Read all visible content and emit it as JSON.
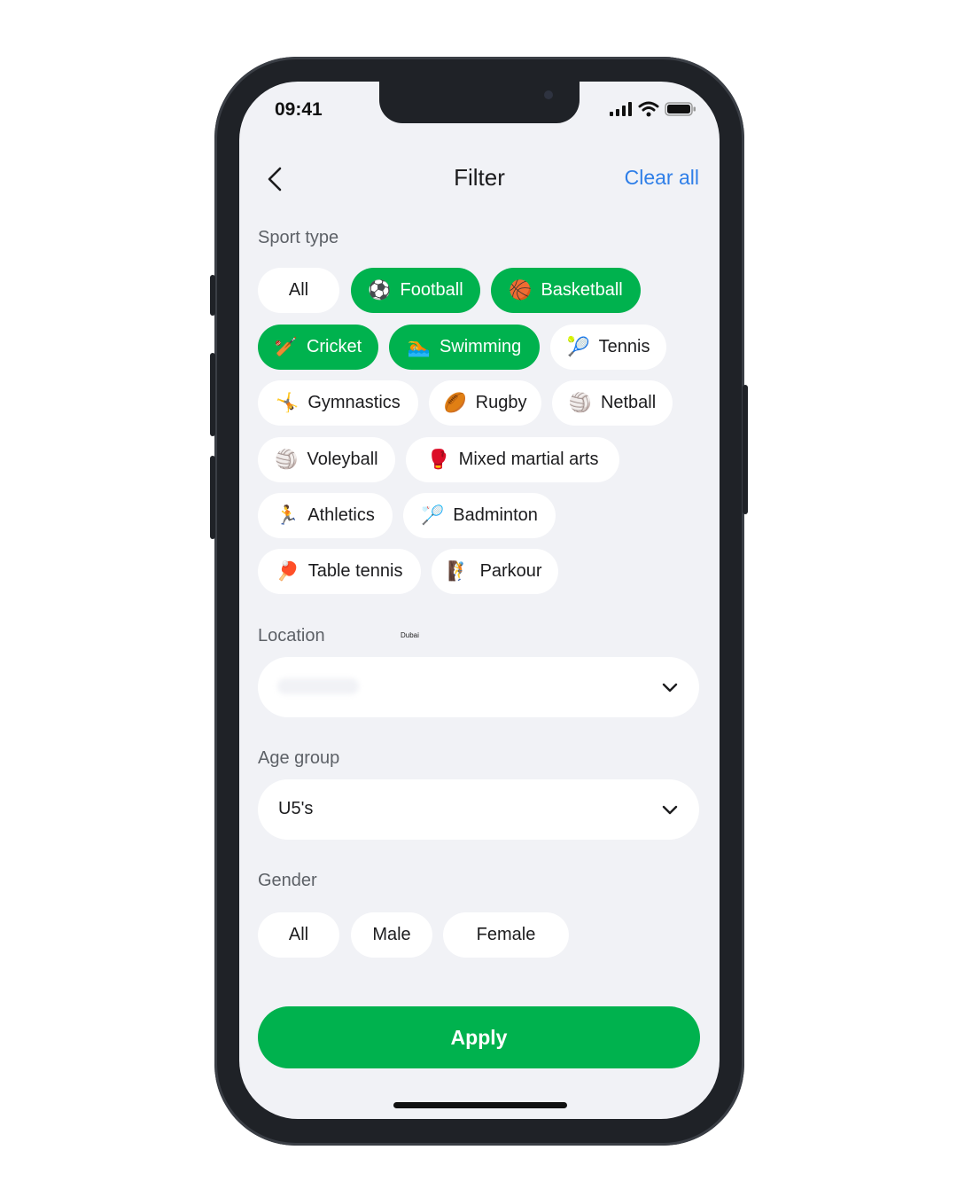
{
  "status": {
    "time": "09:41"
  },
  "header": {
    "title": "Filter",
    "clear_label": "Clear all"
  },
  "sport_type": {
    "label": "Sport type",
    "chips": [
      {
        "label": "All",
        "emoji": "",
        "selected": false
      },
      {
        "label": "Football",
        "emoji": "⚽",
        "selected": true
      },
      {
        "label": "Basketball",
        "emoji": "🏀",
        "selected": true
      },
      {
        "label": "Cricket",
        "emoji": "🏏",
        "selected": true
      },
      {
        "label": "Swimming",
        "emoji": "🏊",
        "selected": true
      },
      {
        "label": "Tennis",
        "emoji": "🎾",
        "selected": false
      },
      {
        "label": "Gymnastics",
        "emoji": "🤸",
        "selected": false
      },
      {
        "label": "Rugby",
        "emoji": "🏉",
        "selected": false
      },
      {
        "label": "Netball",
        "emoji": "🏐",
        "selected": false
      },
      {
        "label": "Voleyball",
        "emoji": "🏐",
        "selected": false
      },
      {
        "label": "Mixed martial arts",
        "emoji": "🥊",
        "selected": false
      },
      {
        "label": "Athletics",
        "emoji": "🏃",
        "selected": false
      },
      {
        "label": "Badminton",
        "emoji": "🏸",
        "selected": false
      },
      {
        "label": "Table tennis",
        "emoji": "🏓",
        "selected": false
      },
      {
        "label": "Parkour",
        "emoji": "🧗",
        "selected": false
      }
    ]
  },
  "location": {
    "label": "Location",
    "hint": "Dubai"
  },
  "age_group": {
    "label": "Age group",
    "value": "U5's"
  },
  "gender": {
    "label": "Gender",
    "options": [
      {
        "label": "All",
        "selected": false
      },
      {
        "label": "Male",
        "selected": false
      },
      {
        "label": "Female",
        "selected": false
      }
    ]
  },
  "apply_label": "Apply",
  "colors": {
    "accent": "#00b24e",
    "link": "#2f7fe8",
    "background": "#f1f2f6"
  }
}
